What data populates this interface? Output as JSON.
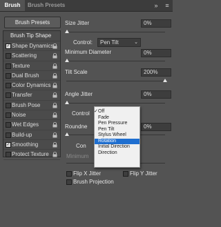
{
  "tabs": [
    "Brush",
    "Brush Presets"
  ],
  "toolbar_icons": [
    "expand-icon",
    "menu-icon"
  ],
  "brush_presets_button": "Brush Presets",
  "sidebar": {
    "header": "Brush Tip Shape",
    "items": [
      {
        "label": "Shape Dynamics",
        "checked": true
      },
      {
        "label": "Scattering",
        "checked": false
      },
      {
        "label": "Texture",
        "checked": false
      },
      {
        "label": "Dual Brush",
        "checked": false
      },
      {
        "label": "Color Dynamics",
        "checked": false
      },
      {
        "label": "Transfer",
        "checked": false
      },
      {
        "label": "Brush Pose",
        "checked": false
      },
      {
        "label": "Noise",
        "checked": false
      },
      {
        "label": "Wet Edges",
        "checked": false
      },
      {
        "label": "Build-up",
        "checked": false
      },
      {
        "label": "Smoothing",
        "checked": true
      },
      {
        "label": "Protect Texture",
        "checked": false
      }
    ]
  },
  "main": {
    "size_jitter": {
      "label": "Size Jitter",
      "value": "0%",
      "level": 0
    },
    "control1": {
      "label": "Control:",
      "value": "Pen Tilt"
    },
    "min_diameter": {
      "label": "Minimum Diameter",
      "value": "0%",
      "level": 0
    },
    "tilt_scale": {
      "label": "Tilt Scale",
      "value": "200%",
      "level": 1.0
    },
    "angle_jitter": {
      "label": "Angle Jitter",
      "value": "0%",
      "level": 0
    },
    "control2": {
      "label": "Control"
    },
    "roundness": {
      "label": "Roundne",
      "value": "0%"
    },
    "control3": {
      "label": "Con"
    },
    "min_roundness": {
      "label": "Minimum"
    },
    "flip_x": "Flip X Jitter",
    "flip_y": "Flip Y Jitter",
    "brush_projection": "Brush Projection"
  },
  "dropdown": {
    "options": [
      "Off",
      "Fade",
      "Pen Pressure",
      "Pen Tilt",
      "Stylus Wheel",
      "Rotation",
      "Initial Direction",
      "Direction"
    ],
    "checked": "Off",
    "highlighted": "Rotation"
  }
}
